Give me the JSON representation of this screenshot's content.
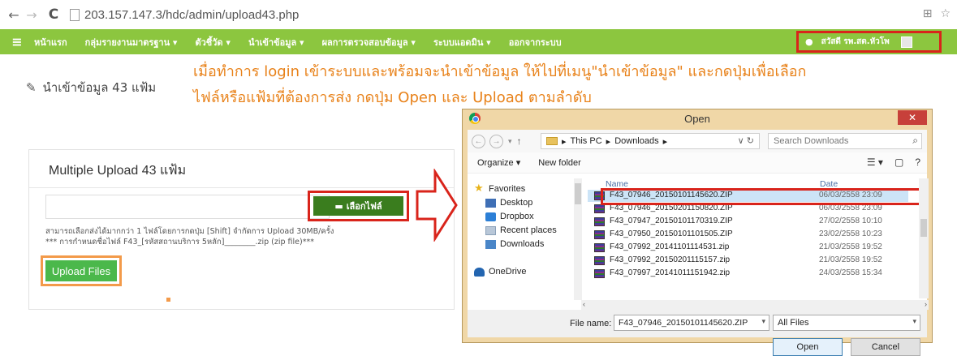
{
  "browser": {
    "url": "203.157.147.3/hdc/admin/upload43.php"
  },
  "navbar": {
    "items": [
      "หน้าแรก",
      "กลุ่มรายงานมาตรฐาน ▾",
      "ตัวชี้วัด ▾",
      "นำเข้าข้อมูล ▾",
      "ผลการตรวจสอบข้อมูล ▾",
      "ระบบแอดมิน ▾",
      "ออกจากระบบ"
    ],
    "user_name": "สวัสดี รพ.สต.หัวโพ",
    "bg_color": "#8cc63f"
  },
  "page": {
    "heading": "นำเข้าข้อมูล 43 แฟ้ม"
  },
  "instruction": {
    "line1": "เมื่อทำการ login เข้าระบบและพร้อมจะนำเข้าข้อมูล ให้ไปที่เมนู\"นำเข้าข้อมูล\" และกดปุ่มเพื่อเลือก",
    "line2": "ไฟล์หรือแฟ้มที่ต้องการส่ง กดปุ่ม Open และ Upload ตามลำดับ"
  },
  "upload_panel": {
    "title": "Multiple Upload 43 แฟ้ม",
    "browse_label": "เลือกไฟล์",
    "help_line1": "สามารถเลือกส่งได้มากกว่า 1 ไฟล์โดยการกดปุ่ม [Shift] จำกัดการ Upload 30MB/ครั้ง",
    "help_line2": "*** การกำหนดชื่อไฟล์ F43_[รหัสสถานบริการ 5หลัก]________.zip (zip file)***",
    "upload_label": "Upload Files"
  },
  "dialog": {
    "title": "Open",
    "path_pc": "This PC",
    "path_folder": "Downloads",
    "search_placeholder": "Search Downloads",
    "organize": "Organize ▾",
    "new_folder": "New folder",
    "nav": {
      "favorites": "Favorites",
      "desktop": "Desktop",
      "dropbox": "Dropbox",
      "recent": "Recent places",
      "downloads": "Downloads",
      "onedrive": "OneDrive"
    },
    "columns": {
      "name": "Name",
      "date": "Date"
    },
    "files": [
      {
        "name": "F43_07946_20150101145620.ZIP",
        "date": "06/03/2558 23:09",
        "selected": true
      },
      {
        "name": "F43_07946_20150201150820.ZIP",
        "date": "06/03/2558 23:09"
      },
      {
        "name": "F43_07947_20150101170319.ZIP",
        "date": "27/02/2558 10:10"
      },
      {
        "name": "F43_07950_20150101101505.ZIP",
        "date": "23/02/2558 10:23"
      },
      {
        "name": "F43_07992_20141101114531.zip",
        "date": "21/03/2558 19:52"
      },
      {
        "name": "F43_07992_20150201115157.zip",
        "date": "21/03/2558 19:52"
      },
      {
        "name": "F43_07997_20141011151942.zip",
        "date": "24/03/2558 15:34"
      }
    ],
    "filename_label": "File name:",
    "filename_value": "F43_07946_20150101145620.ZIP",
    "filter": "All Files",
    "open_label": "Open",
    "cancel_label": "Cancel"
  }
}
